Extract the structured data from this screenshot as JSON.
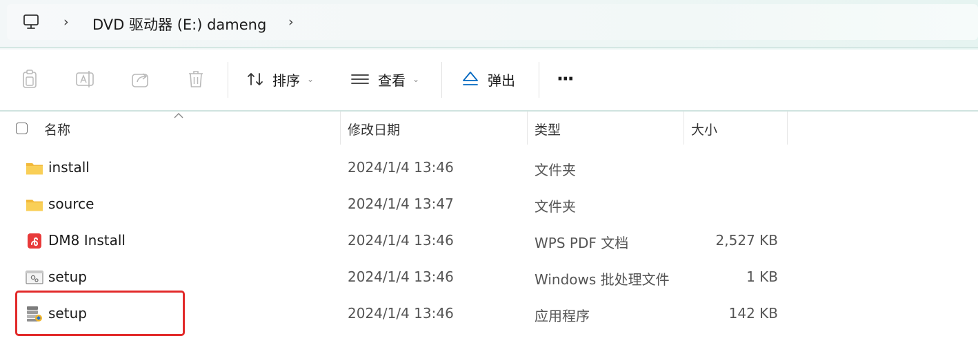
{
  "address": {
    "separator": "›",
    "segments": [
      "DVD 驱动器 (E:) dameng"
    ],
    "icons": {
      "root": "computer-monitor-icon"
    }
  },
  "toolbar": {
    "icons": [
      "copy-icon",
      "rename-icon",
      "share-icon",
      "delete-icon",
      "sort-icon",
      "view-icon",
      "eject-icon",
      "more-icon"
    ],
    "sort_label": "排序",
    "view_label": "查看",
    "eject_label": "弹出",
    "more_label": "···",
    "caret": "⌄"
  },
  "columns": {
    "name": "名称",
    "date": "修改日期",
    "type": "类型",
    "size": "大小"
  },
  "files": [
    {
      "name": "install",
      "date": "2024/1/4 13:46",
      "type": "文件夹",
      "size": "",
      "icon": "folder-icon"
    },
    {
      "name": "source",
      "date": "2024/1/4 13:47",
      "type": "文件夹",
      "size": "",
      "icon": "folder-icon"
    },
    {
      "name": "DM8 Install",
      "date": "2024/1/4 13:46",
      "type": "WPS PDF 文档",
      "size": "2,527 KB",
      "icon": "wps-pdf-icon"
    },
    {
      "name": "setup",
      "date": "2024/1/4 13:46",
      "type": "Windows 批处理文件",
      "size": "1 KB",
      "icon": "batch-file-icon"
    },
    {
      "name": "setup",
      "date": "2024/1/4 13:46",
      "type": "应用程序",
      "size": "142 KB",
      "icon": "application-icon"
    }
  ],
  "colors": {
    "accent": "#0067c0",
    "folder": "#f8c54a",
    "pdf": "#e83a3a",
    "highlight": "#e22a2a"
  }
}
